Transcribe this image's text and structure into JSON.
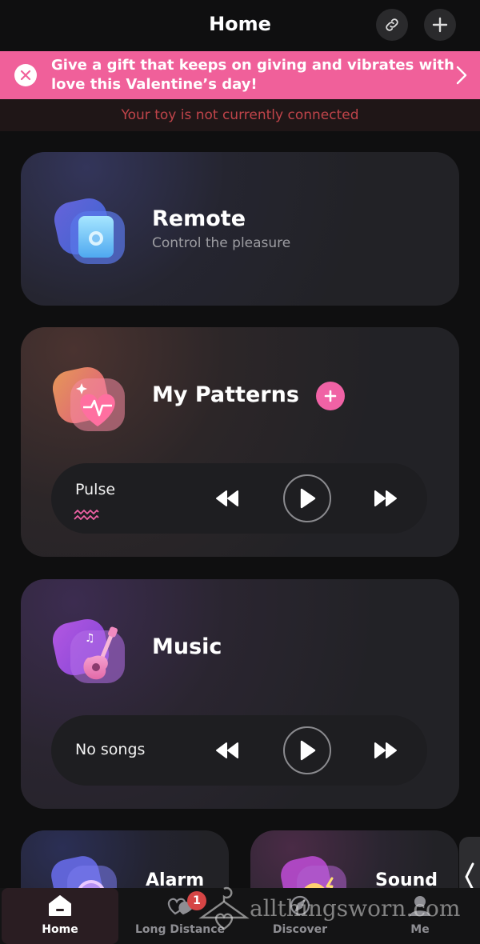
{
  "header": {
    "title": "Home"
  },
  "promo": {
    "text": "Give a gift that keeps on giving and vibrates with love this Valentine’s day!"
  },
  "notice": {
    "text": "Your toy is not currently connected"
  },
  "cards": {
    "remote": {
      "title": "Remote",
      "subtitle": "Control the pleasure"
    },
    "patterns": {
      "title": "My Patterns",
      "player_label": "Pulse"
    },
    "music": {
      "title": "Music",
      "player_label": "No songs"
    },
    "alarm": {
      "title": "Alarm"
    },
    "sound": {
      "title": "Sound"
    }
  },
  "tabs": [
    {
      "label": "Home",
      "icon": "home-icon",
      "active": true
    },
    {
      "label": "Long Distance",
      "icon": "hearts-icon",
      "badge": "1"
    },
    {
      "label": "Discover",
      "icon": "discover-icon"
    },
    {
      "label": "Me",
      "icon": "profile-icon"
    }
  ],
  "watermark": "allthingsworn.com",
  "colors": {
    "accent_pink": "#f062a5",
    "banner_pink": "#f0609a",
    "warning_red": "#c0444a",
    "background": "#0f0f10"
  }
}
